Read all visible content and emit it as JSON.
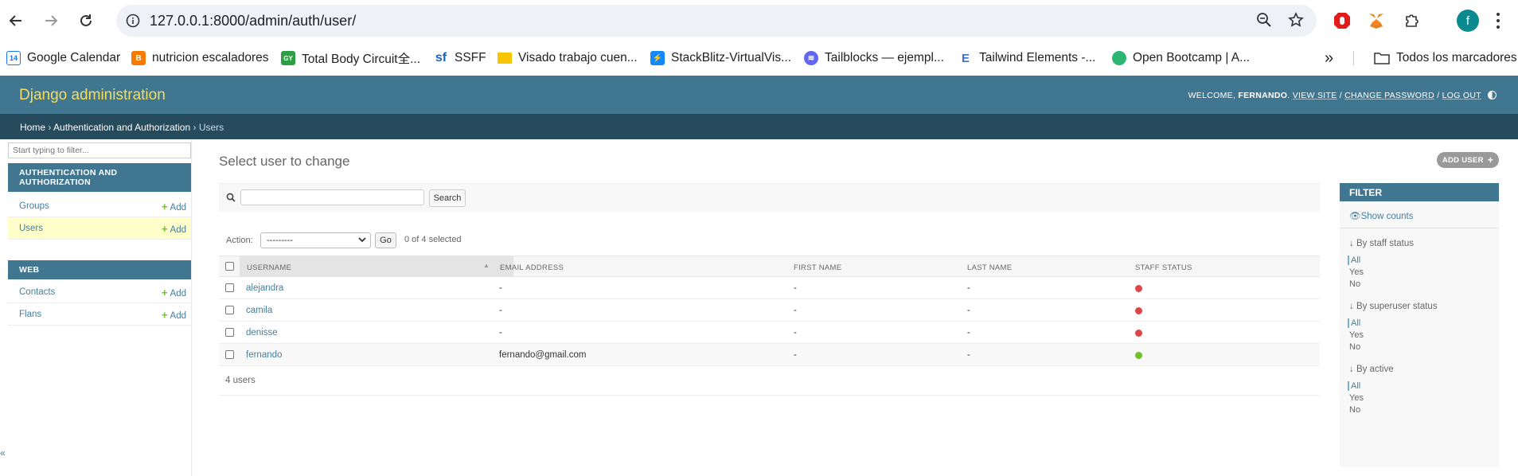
{
  "browser": {
    "url": "127.0.0.1:8000/admin/auth/user/",
    "profile_initial": "f",
    "bookmarks": [
      {
        "label": "Google Calendar",
        "icon": "calendar-icon",
        "color": "#1a73e8"
      },
      {
        "label": "nutricion escaladores",
        "icon": "blogger-icon",
        "color": "#f57c00"
      },
      {
        "label": "Total Body Circuit全...",
        "icon": "gym-icon",
        "color": "#2e9e44"
      },
      {
        "label": "SSFF",
        "icon": "ssff-icon",
        "color": "#1565c0"
      },
      {
        "label": "Visado trabajo cuen...",
        "icon": "flag-icon",
        "color": "#f9c400"
      },
      {
        "label": "StackBlitz-VirtualVis...",
        "icon": "bolt-icon",
        "color": "#1389fd"
      },
      {
        "label": "Tailblocks — ejempl...",
        "icon": "tailblocks-icon",
        "color": "#6366f1"
      },
      {
        "label": "Tailwind Elements -...",
        "icon": "te-icon",
        "color": "#3b71ca"
      },
      {
        "label": "Open Bootcamp | A...",
        "icon": "ob-icon",
        "color": "#2bb673"
      }
    ],
    "more_label": "»",
    "all_bookmarks_label": "Todos los marcadores"
  },
  "header": {
    "branding": "Django administration",
    "welcome": "WELCOME,",
    "username": "FERNANDO",
    "view_site": "VIEW SITE",
    "change_password": "CHANGE PASSWORD",
    "log_out": "LOG OUT",
    "separator": "/"
  },
  "breadcrumbs": {
    "home": "Home",
    "app": "Authentication and Authorization",
    "current": "Users",
    "sep": "›"
  },
  "sidebar": {
    "filter_placeholder": "Start typing to filter...",
    "modules": [
      {
        "caption": "AUTHENTICATION AND AUTHORIZATION",
        "models": [
          {
            "name": "Groups",
            "add": "Add"
          },
          {
            "name": "Users",
            "add": "Add"
          }
        ]
      },
      {
        "caption": "WEB",
        "models": [
          {
            "name": "Contacts",
            "add": "Add"
          },
          {
            "name": "Flans",
            "add": "Add"
          }
        ]
      }
    ],
    "collapse": "«"
  },
  "content": {
    "title": "Select user to change",
    "add_button": "ADD USER",
    "search_button": "Search",
    "search_value": "",
    "action_label": "Action:",
    "action_selected": "---------",
    "go_button": "Go",
    "selection_counter": "0 of 4 selected",
    "columns": [
      "USERNAME",
      "EMAIL ADDRESS",
      "FIRST NAME",
      "LAST NAME",
      "STAFF STATUS"
    ],
    "rows": [
      {
        "username": "alejandra",
        "email": "-",
        "first_name": "-",
        "last_name": "-",
        "staff": false
      },
      {
        "username": "camila",
        "email": "-",
        "first_name": "-",
        "last_name": "-",
        "staff": false
      },
      {
        "username": "denisse",
        "email": "-",
        "first_name": "-",
        "last_name": "-",
        "staff": false
      },
      {
        "username": "fernando",
        "email": "fernando@gmail.com",
        "first_name": "-",
        "last_name": "-",
        "staff": true
      }
    ],
    "paginator": "4 users"
  },
  "filter": {
    "title": "FILTER",
    "show_counts": "Show counts",
    "groups": [
      {
        "title": "↓ By staff status",
        "options": [
          "All",
          "Yes",
          "No"
        ],
        "selected": "All"
      },
      {
        "title": "↓ By superuser status",
        "options": [
          "All",
          "Yes",
          "No"
        ],
        "selected": "All"
      },
      {
        "title": "↓ By active",
        "options": [
          "All",
          "Yes",
          "No"
        ],
        "selected": "All"
      }
    ]
  },
  "colors": {
    "header": "#417690",
    "breadcrumbs": "#264b5d",
    "branding": "#f5dd5d",
    "link": "#447e9b",
    "add_green": "#70bf2b",
    "status_no": "#dd4646",
    "current_row": "#ffffcc"
  }
}
